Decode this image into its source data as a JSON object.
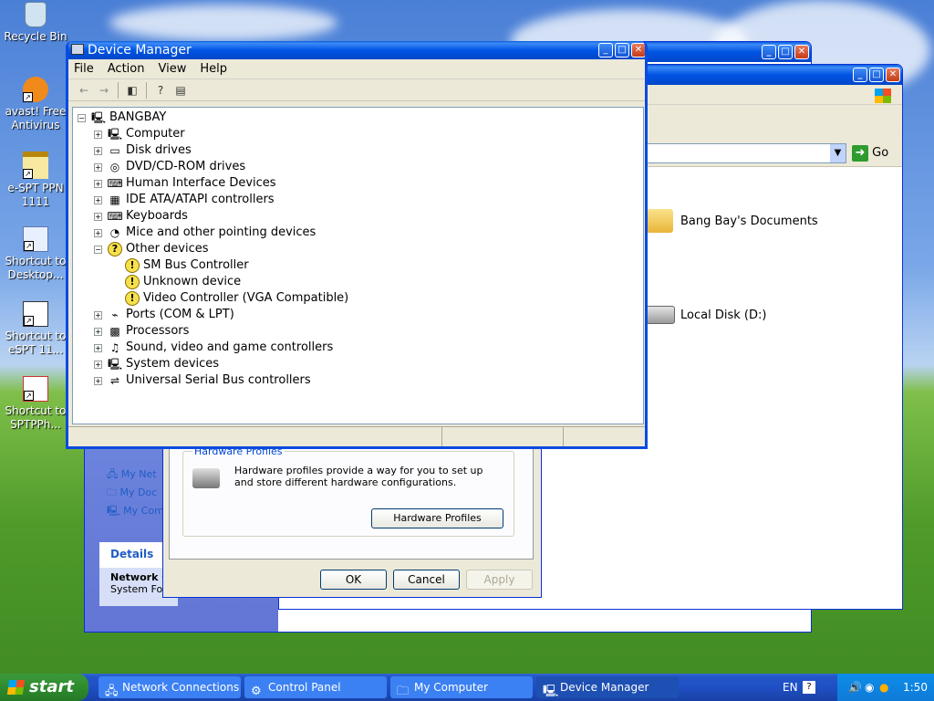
{
  "desktop": {
    "icons": [
      {
        "label": "Recycle Bin"
      },
      {
        "label": "avast! Free Antivirus"
      },
      {
        "label": "e-SPT PPN 1111"
      },
      {
        "label": "Shortcut to Desktop..."
      },
      {
        "label": "Shortcut to eSPT 11..."
      },
      {
        "label": "Shortcut to SPTPPh..."
      }
    ]
  },
  "back_windows": {
    "go_label": "Go",
    "documents_label": "Bang Bay's Documents",
    "local_disk_label": "Local Disk (D:)",
    "left_links": [
      "My Net",
      "My Doc",
      "My Com"
    ],
    "details_header": "Details",
    "details_title": "Network C",
    "details_sub": "System Fold",
    "hardware_profiles": {
      "group_title": "Hardware Profiles",
      "description": "Hardware profiles provide a way for you to set up and store different hardware configurations.",
      "button": "Hardware Profiles"
    },
    "ok": "OK",
    "cancel": "Cancel",
    "apply": "Apply"
  },
  "device_manager": {
    "title": "Device Manager",
    "menu": [
      "File",
      "Action",
      "View",
      "Help"
    ],
    "root": "BANGBAY",
    "categories": [
      {
        "label": "Computer",
        "icon": "computer-icon",
        "expanded": false
      },
      {
        "label": "Disk drives",
        "icon": "disk-drive-icon",
        "expanded": false
      },
      {
        "label": "DVD/CD-ROM drives",
        "icon": "cdrom-icon",
        "expanded": false
      },
      {
        "label": "Human Interface Devices",
        "icon": "hid-icon",
        "expanded": false
      },
      {
        "label": "IDE ATA/ATAPI controllers",
        "icon": "ide-controller-icon",
        "expanded": false
      },
      {
        "label": "Keyboards",
        "icon": "keyboard-icon",
        "expanded": false
      },
      {
        "label": "Mice and other pointing devices",
        "icon": "mouse-icon",
        "expanded": false
      },
      {
        "label": "Other devices",
        "icon": "unknown-device-icon",
        "expanded": true
      },
      {
        "label": "Ports (COM & LPT)",
        "icon": "port-icon",
        "expanded": false
      },
      {
        "label": "Processors",
        "icon": "processor-icon",
        "expanded": false
      },
      {
        "label": "Sound, video and game controllers",
        "icon": "sound-icon",
        "expanded": false
      },
      {
        "label": "System devices",
        "icon": "system-device-icon",
        "expanded": false
      },
      {
        "label": "Universal Serial Bus controllers",
        "icon": "usb-icon",
        "expanded": false
      }
    ],
    "other_devices": [
      "SM Bus Controller",
      "Unknown device",
      "Video Controller (VGA Compatible)"
    ]
  },
  "taskbar": {
    "start": "start",
    "tasks": [
      {
        "label": "Network Connections"
      },
      {
        "label": "Control Panel"
      },
      {
        "label": "My Computer"
      },
      {
        "label": "Device Manager"
      }
    ],
    "language": "EN",
    "clock": "1:50"
  },
  "colors": {
    "titlebar": "#0054e3",
    "taskbar": "#245edb",
    "start": "#2e8b2e"
  }
}
